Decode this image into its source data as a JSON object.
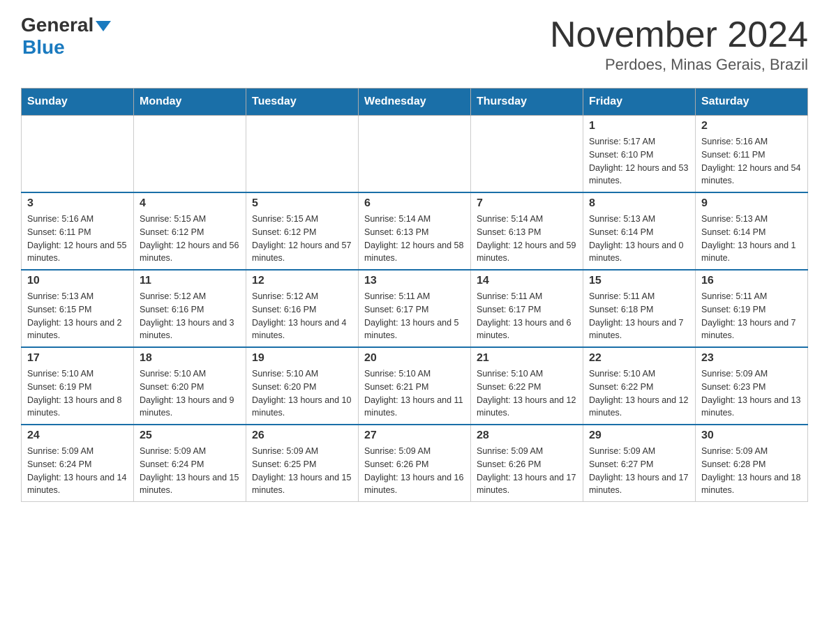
{
  "header": {
    "logo_general": "General",
    "logo_blue": "Blue",
    "title": "November 2024",
    "location": "Perdoes, Minas Gerais, Brazil"
  },
  "days_of_week": [
    "Sunday",
    "Monday",
    "Tuesday",
    "Wednesday",
    "Thursday",
    "Friday",
    "Saturday"
  ],
  "weeks": [
    [
      {
        "day": "",
        "sunrise": "",
        "sunset": "",
        "daylight": ""
      },
      {
        "day": "",
        "sunrise": "",
        "sunset": "",
        "daylight": ""
      },
      {
        "day": "",
        "sunrise": "",
        "sunset": "",
        "daylight": ""
      },
      {
        "day": "",
        "sunrise": "",
        "sunset": "",
        "daylight": ""
      },
      {
        "day": "",
        "sunrise": "",
        "sunset": "",
        "daylight": ""
      },
      {
        "day": "1",
        "sunrise": "Sunrise: 5:17 AM",
        "sunset": "Sunset: 6:10 PM",
        "daylight": "Daylight: 12 hours and 53 minutes."
      },
      {
        "day": "2",
        "sunrise": "Sunrise: 5:16 AM",
        "sunset": "Sunset: 6:11 PM",
        "daylight": "Daylight: 12 hours and 54 minutes."
      }
    ],
    [
      {
        "day": "3",
        "sunrise": "Sunrise: 5:16 AM",
        "sunset": "Sunset: 6:11 PM",
        "daylight": "Daylight: 12 hours and 55 minutes."
      },
      {
        "day": "4",
        "sunrise": "Sunrise: 5:15 AM",
        "sunset": "Sunset: 6:12 PM",
        "daylight": "Daylight: 12 hours and 56 minutes."
      },
      {
        "day": "5",
        "sunrise": "Sunrise: 5:15 AM",
        "sunset": "Sunset: 6:12 PM",
        "daylight": "Daylight: 12 hours and 57 minutes."
      },
      {
        "day": "6",
        "sunrise": "Sunrise: 5:14 AM",
        "sunset": "Sunset: 6:13 PM",
        "daylight": "Daylight: 12 hours and 58 minutes."
      },
      {
        "day": "7",
        "sunrise": "Sunrise: 5:14 AM",
        "sunset": "Sunset: 6:13 PM",
        "daylight": "Daylight: 12 hours and 59 minutes."
      },
      {
        "day": "8",
        "sunrise": "Sunrise: 5:13 AM",
        "sunset": "Sunset: 6:14 PM",
        "daylight": "Daylight: 13 hours and 0 minutes."
      },
      {
        "day": "9",
        "sunrise": "Sunrise: 5:13 AM",
        "sunset": "Sunset: 6:14 PM",
        "daylight": "Daylight: 13 hours and 1 minute."
      }
    ],
    [
      {
        "day": "10",
        "sunrise": "Sunrise: 5:13 AM",
        "sunset": "Sunset: 6:15 PM",
        "daylight": "Daylight: 13 hours and 2 minutes."
      },
      {
        "day": "11",
        "sunrise": "Sunrise: 5:12 AM",
        "sunset": "Sunset: 6:16 PM",
        "daylight": "Daylight: 13 hours and 3 minutes."
      },
      {
        "day": "12",
        "sunrise": "Sunrise: 5:12 AM",
        "sunset": "Sunset: 6:16 PM",
        "daylight": "Daylight: 13 hours and 4 minutes."
      },
      {
        "day": "13",
        "sunrise": "Sunrise: 5:11 AM",
        "sunset": "Sunset: 6:17 PM",
        "daylight": "Daylight: 13 hours and 5 minutes."
      },
      {
        "day": "14",
        "sunrise": "Sunrise: 5:11 AM",
        "sunset": "Sunset: 6:17 PM",
        "daylight": "Daylight: 13 hours and 6 minutes."
      },
      {
        "day": "15",
        "sunrise": "Sunrise: 5:11 AM",
        "sunset": "Sunset: 6:18 PM",
        "daylight": "Daylight: 13 hours and 7 minutes."
      },
      {
        "day": "16",
        "sunrise": "Sunrise: 5:11 AM",
        "sunset": "Sunset: 6:19 PM",
        "daylight": "Daylight: 13 hours and 7 minutes."
      }
    ],
    [
      {
        "day": "17",
        "sunrise": "Sunrise: 5:10 AM",
        "sunset": "Sunset: 6:19 PM",
        "daylight": "Daylight: 13 hours and 8 minutes."
      },
      {
        "day": "18",
        "sunrise": "Sunrise: 5:10 AM",
        "sunset": "Sunset: 6:20 PM",
        "daylight": "Daylight: 13 hours and 9 minutes."
      },
      {
        "day": "19",
        "sunrise": "Sunrise: 5:10 AM",
        "sunset": "Sunset: 6:20 PM",
        "daylight": "Daylight: 13 hours and 10 minutes."
      },
      {
        "day": "20",
        "sunrise": "Sunrise: 5:10 AM",
        "sunset": "Sunset: 6:21 PM",
        "daylight": "Daylight: 13 hours and 11 minutes."
      },
      {
        "day": "21",
        "sunrise": "Sunrise: 5:10 AM",
        "sunset": "Sunset: 6:22 PM",
        "daylight": "Daylight: 13 hours and 12 minutes."
      },
      {
        "day": "22",
        "sunrise": "Sunrise: 5:10 AM",
        "sunset": "Sunset: 6:22 PM",
        "daylight": "Daylight: 13 hours and 12 minutes."
      },
      {
        "day": "23",
        "sunrise": "Sunrise: 5:09 AM",
        "sunset": "Sunset: 6:23 PM",
        "daylight": "Daylight: 13 hours and 13 minutes."
      }
    ],
    [
      {
        "day": "24",
        "sunrise": "Sunrise: 5:09 AM",
        "sunset": "Sunset: 6:24 PM",
        "daylight": "Daylight: 13 hours and 14 minutes."
      },
      {
        "day": "25",
        "sunrise": "Sunrise: 5:09 AM",
        "sunset": "Sunset: 6:24 PM",
        "daylight": "Daylight: 13 hours and 15 minutes."
      },
      {
        "day": "26",
        "sunrise": "Sunrise: 5:09 AM",
        "sunset": "Sunset: 6:25 PM",
        "daylight": "Daylight: 13 hours and 15 minutes."
      },
      {
        "day": "27",
        "sunrise": "Sunrise: 5:09 AM",
        "sunset": "Sunset: 6:26 PM",
        "daylight": "Daylight: 13 hours and 16 minutes."
      },
      {
        "day": "28",
        "sunrise": "Sunrise: 5:09 AM",
        "sunset": "Sunset: 6:26 PM",
        "daylight": "Daylight: 13 hours and 17 minutes."
      },
      {
        "day": "29",
        "sunrise": "Sunrise: 5:09 AM",
        "sunset": "Sunset: 6:27 PM",
        "daylight": "Daylight: 13 hours and 17 minutes."
      },
      {
        "day": "30",
        "sunrise": "Sunrise: 5:09 AM",
        "sunset": "Sunset: 6:28 PM",
        "daylight": "Daylight: 13 hours and 18 minutes."
      }
    ]
  ]
}
